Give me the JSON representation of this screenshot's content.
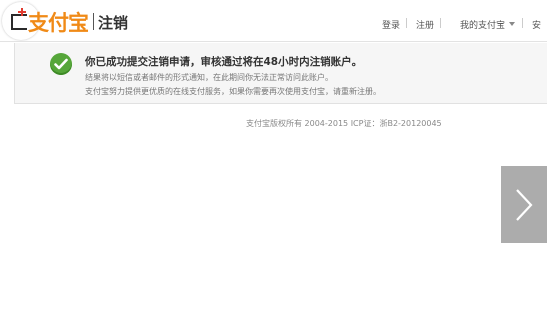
{
  "header": {
    "logo_text": "支付宝",
    "page_name": "注销",
    "nav": {
      "login": "登录",
      "register": "注册",
      "my_alipay": "我的支付宝",
      "more": "安"
    }
  },
  "notice": {
    "title": "你已成功提交注销申请，审核通过将在48小时内注销账户。",
    "line1": "结果将以短信或者邮件的形式通知，在此期间你无法正常访问此账户。",
    "line2": "支付宝努力提供更优质的在线支付服务，如果你需要再次使用支付宝，请重新注册。"
  },
  "footer": {
    "copyright": "支付宝版权所有 2004-2015 ICP证：浙B2-20120045"
  },
  "colors": {
    "brand": "#f08a17",
    "success": "#56a63a",
    "notice_bg": "#f6f6f6"
  }
}
